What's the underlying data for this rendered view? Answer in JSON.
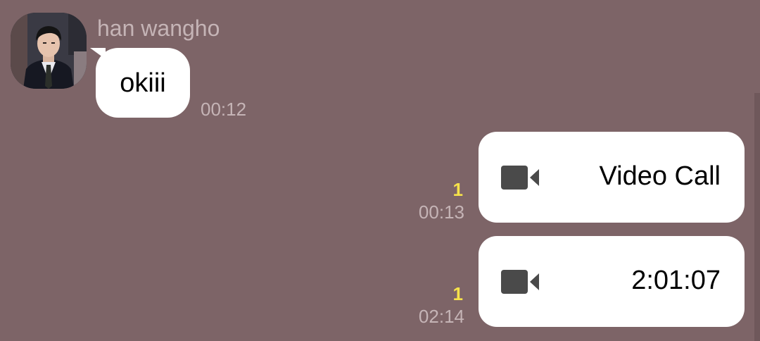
{
  "conversation": {
    "sender_name": "han wangho",
    "incoming": {
      "text": "okiii",
      "time": "00:12"
    },
    "outgoing": [
      {
        "type": "video-call",
        "icon": "video-camera-icon",
        "text": "Video Call",
        "unread_count": "1",
        "time": "00:13"
      },
      {
        "type": "video-call",
        "icon": "video-camera-icon",
        "text": "2:01:07",
        "unread_count": "1",
        "time": "02:14"
      }
    ]
  },
  "colors": {
    "background": "#7d6467",
    "bubble": "#ffffff",
    "muted_text": "#c5b4b6",
    "unread": "#f6e24a",
    "icon": "#4a4a4a"
  }
}
